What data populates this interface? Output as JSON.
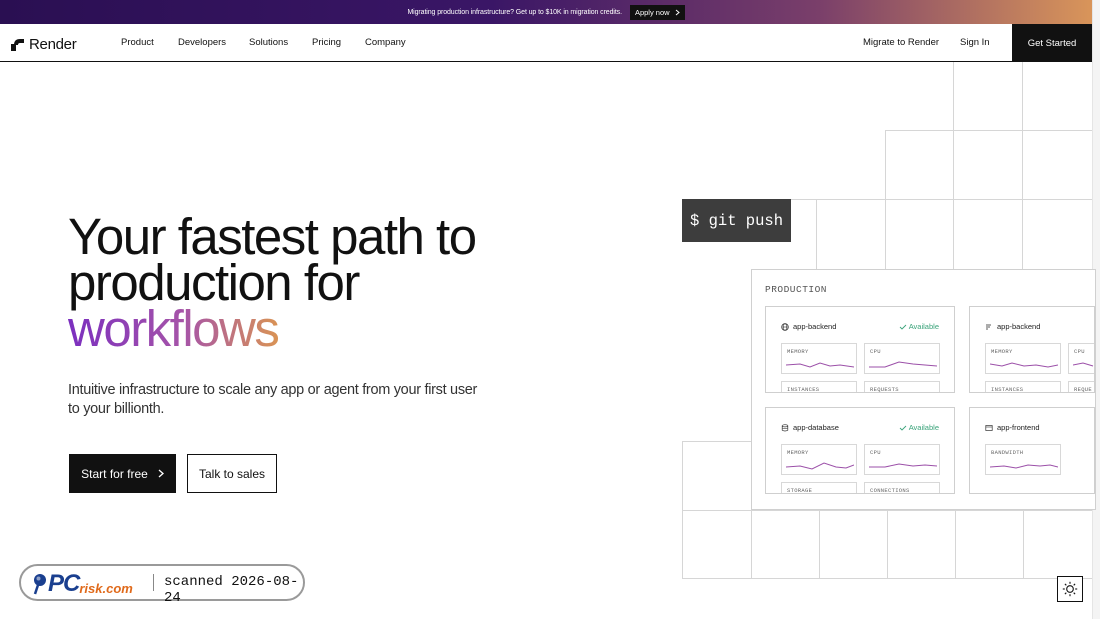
{
  "promo": {
    "text": "Migrating production infrastructure? Get up to $10K in migration credits.",
    "button": "Apply now"
  },
  "nav": {
    "brand": "Render",
    "links": [
      "Product",
      "Developers",
      "Solutions",
      "Pricing",
      "Company"
    ],
    "migrate": "Migrate to Render",
    "sign_in": "Sign In",
    "get_started": "Get Started"
  },
  "hero": {
    "title_line1": "Your fastest path to",
    "title_line2": "production for",
    "title_highlight": "workflows",
    "subtitle": "Intuitive infrastructure to scale any app or agent from your first user to your billionth.",
    "primary_cta": "Start for free",
    "secondary_cta": "Talk to sales"
  },
  "illustration": {
    "command": "$ git push",
    "panel_label": "PRODUCTION",
    "cards": [
      {
        "name": "app-backend",
        "icon": "globe-icon",
        "status": "Available",
        "metrics": [
          "MEMORY",
          "CPU",
          "INSTANCES",
          "REQUESTS"
        ]
      },
      {
        "name": "app-backend",
        "icon": "list-icon",
        "status": "",
        "metrics": [
          "MEMORY",
          "CPU",
          "INSTANCES",
          "REQUE"
        ]
      },
      {
        "name": "app-database",
        "icon": "database-icon",
        "status": "Available",
        "metrics": [
          "MEMORY",
          "CPU",
          "STORAGE",
          "CONNECTIONS"
        ]
      },
      {
        "name": "app-frontend",
        "icon": "browser-icon",
        "status": "",
        "metrics": [
          "BANDWIDTH"
        ]
      }
    ]
  },
  "watermark": {
    "logo_main": "PC",
    "logo_rest": "risk.com",
    "text": "scanned 2026-08-24"
  },
  "colors": {
    "accent_purple": "#7b2fbf",
    "accent_orange": "#d99355",
    "status_green": "#3aa37a",
    "sparkline": "#9b4fa8"
  }
}
